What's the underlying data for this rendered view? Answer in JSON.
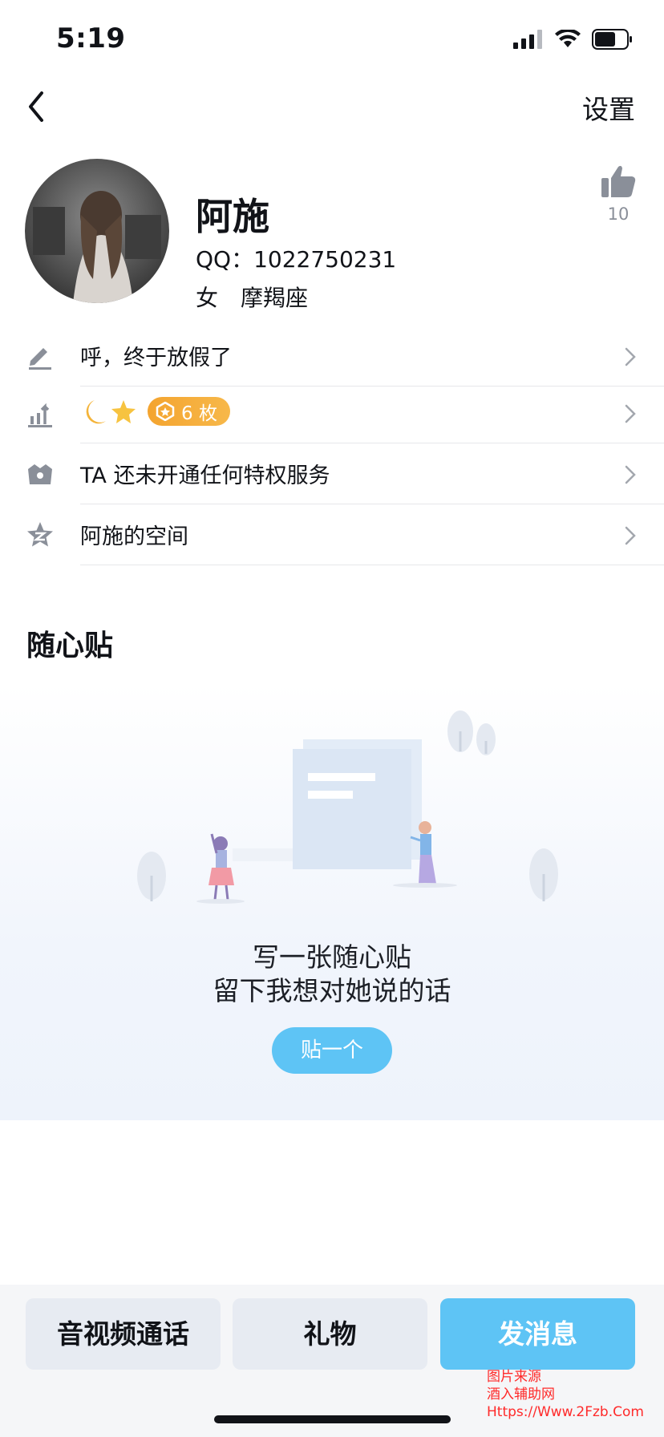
{
  "status_bar": {
    "time": "5:19"
  },
  "nav": {
    "settings_label": "设置"
  },
  "profile": {
    "name": "阿施",
    "qq": "QQ：1022750231",
    "gender_zodiac": "女　摩羯座",
    "like_count": "10"
  },
  "rows": [
    {
      "label": "呼，终于放假了",
      "icon": "pencil-icon"
    },
    {
      "label": "",
      "icon": "level-icon",
      "badge": "6 枚"
    },
    {
      "label": "TA 还未开通任何特权服务",
      "icon": "crown-icon"
    },
    {
      "label": "阿施的空间",
      "icon": "qzone-star-icon"
    }
  ],
  "section": {
    "title": "随心贴"
  },
  "empty_state": {
    "line1": "写一张随心贴",
    "line2": "留下我想对她说的话",
    "button": "贴一个"
  },
  "bottom_bar": {
    "call": "音视频通话",
    "gift": "礼物",
    "message": "发消息"
  },
  "watermark": {
    "line1": "图片来源",
    "line2": "酒入辅助网",
    "line3": "Https://Www.2Fzb.Com"
  },
  "colors": {
    "accent": "#5ec4f5",
    "badge": "#f4a42f",
    "icon_gray": "#8a8f99"
  }
}
